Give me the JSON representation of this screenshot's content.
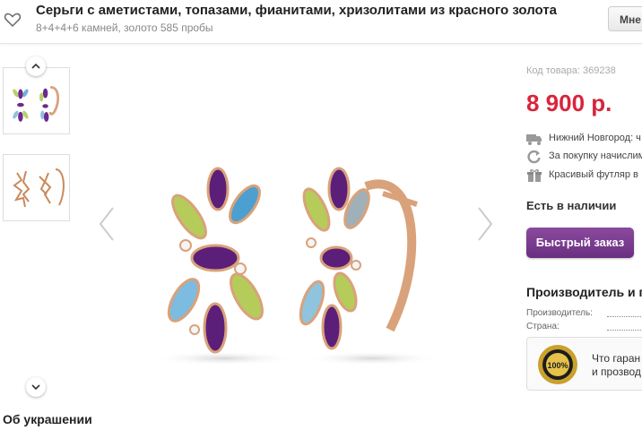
{
  "header": {
    "title": "Серьги с аметистами, топазами, фианитами, хризолитами из красного золота",
    "subtitle": "8+4+4+6 камней, золото 585 пробы",
    "button_label": "Мне"
  },
  "gallery": {
    "thumbnails": [
      "earrings-colored-stones",
      "earrings-gold-openwork"
    ]
  },
  "product": {
    "code": "Код товара: 369238",
    "price": "8 900 р.",
    "info": [
      {
        "icon": "truck-icon",
        "text": "Нижний Новгород: ч"
      },
      {
        "icon": "refresh-icon",
        "text": "За покупку начислим"
      },
      {
        "icon": "gift-icon",
        "text": "Красивый футляр в"
      }
    ],
    "stock": "Есть в наличии",
    "quick_order": "Быстрый заказ"
  },
  "manufacturer": {
    "title": "Производитель и п",
    "rows": [
      {
        "label": "Производитель:"
      },
      {
        "label": "Страна:"
      }
    ]
  },
  "guarantee": {
    "line1": "Что гаран",
    "line2": "и прозвод"
  },
  "about": {
    "title": "Об украшении"
  },
  "colors": {
    "price": "#d8253c",
    "buy_button": "#7a3b8f",
    "gold": "#d9a27a"
  }
}
